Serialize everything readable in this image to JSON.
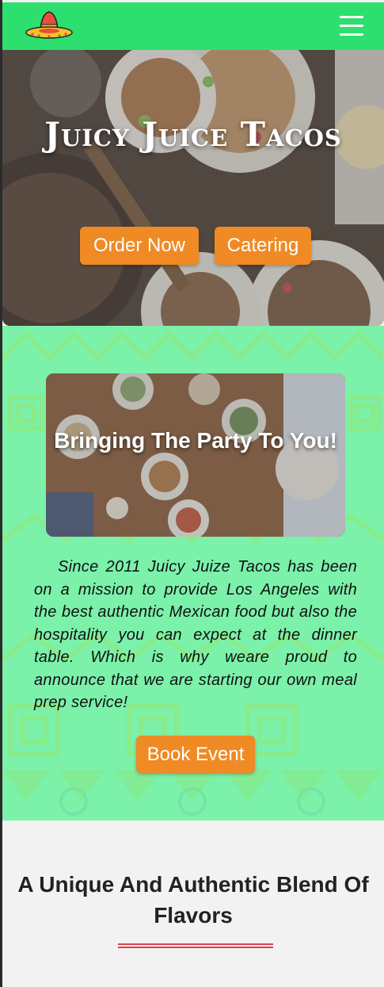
{
  "nav": {
    "logo_icon": "sombrero-icon",
    "menu_icon": "hamburger-menu-icon"
  },
  "hero": {
    "title": "Juicy Juice Tacos",
    "order_button": "Order Now",
    "catering_button": "Catering"
  },
  "party": {
    "card_title": "Bringing The Party To You!",
    "story": "Since 2011 Juicy Juize Tacos has been on a mission to provide Los Angeles with the best authentic Mexican food but also the hospitality you can expect at the dinner table. Which is why weare proud to announce that we are starting our own meal prep service!",
    "book_button": "Book Event"
  },
  "flavors": {
    "title": "A Unique And Authentic Blend Of Flavors"
  },
  "colors": {
    "nav": "#2ddf6e",
    "button": "#ef8a25",
    "divider": "#d9424b",
    "pattern": "#7cf0b0"
  }
}
